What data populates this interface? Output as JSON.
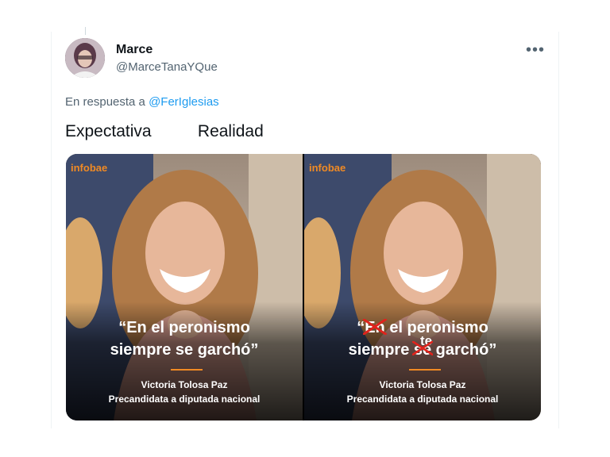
{
  "author": {
    "name": "Marce",
    "handle": "@MarceTanaYQue"
  },
  "menu_glyph": "•••",
  "reply": {
    "prefix": "En respuesta a",
    "mention": "@FerIglesias"
  },
  "tweet": {
    "text": "Expectativa          Realidad"
  },
  "images": {
    "brand": "infobae",
    "left": {
      "quote_line1": "“En el peronismo",
      "quote_line2": "siempre se garchó”",
      "caption_line1": "Victoria Tolosa Paz",
      "caption_line2": "Precandidata a diputada nacional"
    },
    "right": {
      "quote_open": "“",
      "struck_word1": "En",
      "quote_line1_rest": " el peronismo",
      "quote_line2_start": "siempre ",
      "struck_word2": "se",
      "quote_line2_end": " garchó”",
      "inserted_word": "te",
      "caption_line1": "Victoria Tolosa Paz",
      "caption_line2": "Precandidata a diputada nacional"
    }
  },
  "colors": {
    "link": "#1d9bf0",
    "brand_orange": "#f08a24",
    "strike_red": "#e0231c"
  }
}
